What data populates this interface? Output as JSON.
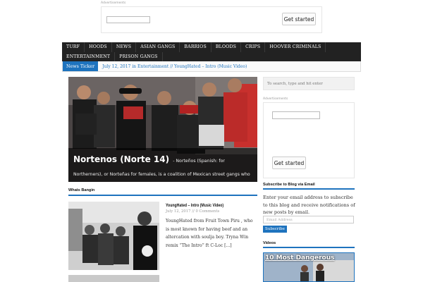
{
  "top_ad": {
    "label": "Advertisements",
    "button": "Get started"
  },
  "nav": {
    "items": [
      "TURF",
      "HOODS",
      "NEWS",
      "ASIAN GANGS",
      "BARRIOS",
      "BLOODS",
      "CRIPS",
      "HOOVER CRIMINALS",
      "ENTERTAINMENT",
      "PRISON GANGS"
    ]
  },
  "ticker": {
    "label": "News Ticker",
    "text": "July 12, 2017 in Entertainment // YoungHated – Intro (Music Video)"
  },
  "featured": {
    "title": "Nortenos (Norte 14)",
    "excerpt": "- Norteños (Spanish: for Northerners), or Norteñas for females, is a coalition of Mexican street gangs who pay tribute to Nuestra Familia (Our Family)."
  },
  "whats_bangin": {
    "heading": "Whats Bangin",
    "post": {
      "title": "YoungHated – Intro (Music Video)",
      "date": "July 12, 2017",
      "comments": "0 Comments",
      "excerpt": "YoungHated from Fruit Town Piru , who is most known for having beef and an altercation with soulja boy. Tryna Win remix “The Intro” ft C-Loc [...]"
    }
  },
  "sidebar": {
    "search_placeholder": "To search, type and hit enter",
    "ad_label": "Advertisements",
    "ad_button": "Get started",
    "subscribe_heading": "Subscribe to Blog via Email",
    "subscribe_text": "Enter your email address to subscribe to this blog and receive notifications of new posts by email.",
    "email_placeholder": "Email Address",
    "subscribe_button": "Subscribe",
    "videos_heading": "Videos",
    "video_title": "10 Most Dangerous"
  },
  "colors": {
    "accent": "#1e73be",
    "nav_bg": "#222222"
  }
}
